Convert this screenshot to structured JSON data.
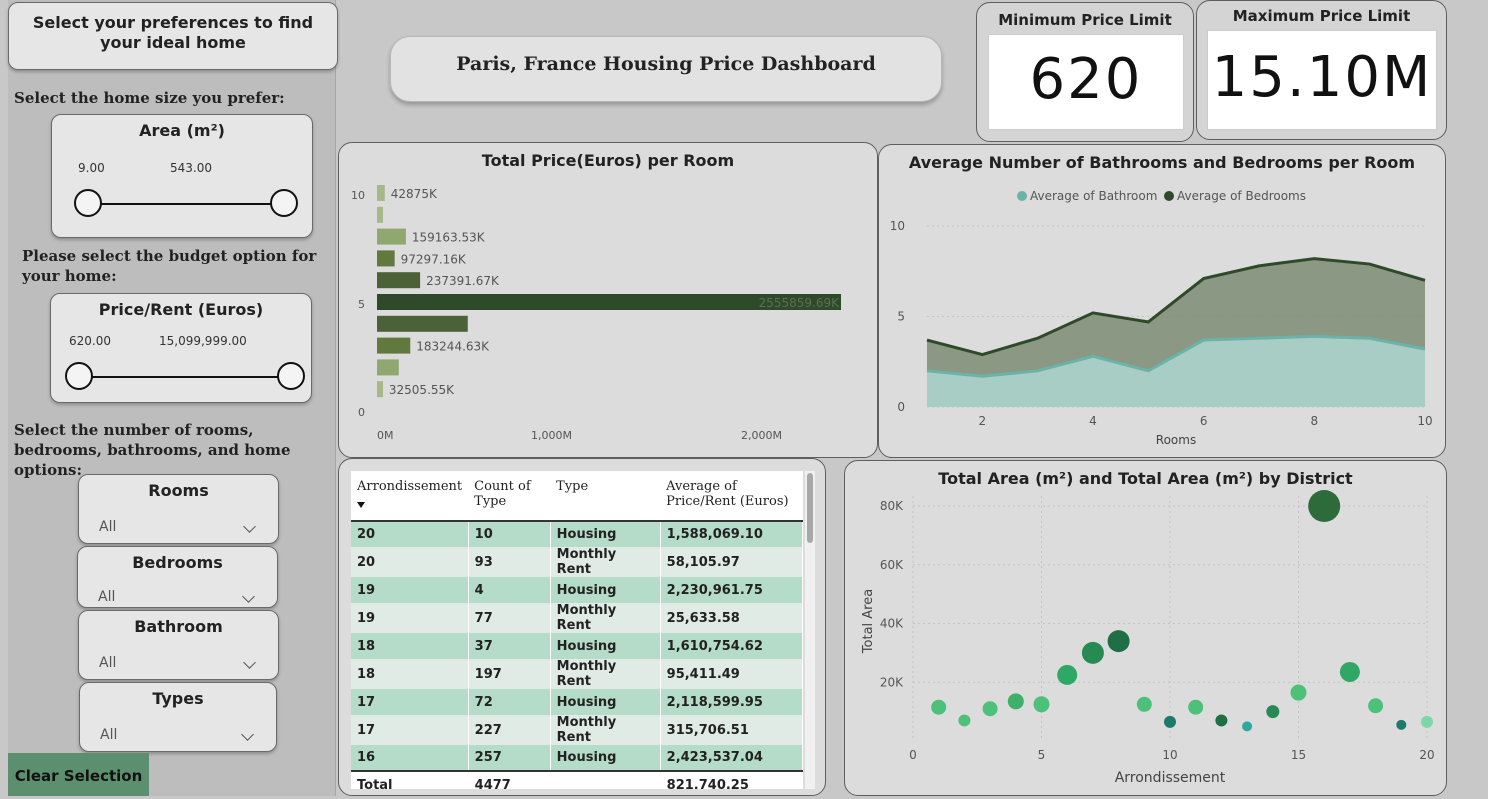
{
  "sidebar": {
    "header": "Select your preferences to find your ideal home",
    "size_prompt": "Select the home size you prefer:",
    "area_slider": {
      "title": "Area (m²)",
      "min": "9.00",
      "max": "543.00"
    },
    "budget_prompt": "Please select the budget option for your home:",
    "price_slider": {
      "title": "Price/Rent (Euros)",
      "min": "620.00",
      "max": "15,099,999.00"
    },
    "rooms_prompt": "Select the number of rooms, bedrooms, bathrooms, and home options:",
    "filters": [
      {
        "title": "Rooms",
        "value": "All"
      },
      {
        "title": "Bedrooms",
        "value": "All"
      },
      {
        "title": "Bathroom",
        "value": "All"
      },
      {
        "title": "Types",
        "value": "All"
      }
    ],
    "clear_label": "Clear Selection"
  },
  "dashboard_title": "Paris, France Housing Price Dashboard",
  "kpis": {
    "min": {
      "title": "Minimum Price Limit",
      "value": "620"
    },
    "max": {
      "title": "Maximum Price Limit",
      "value": "15.10M"
    }
  },
  "table": {
    "headers": [
      "Arrondissement",
      "Count of Type",
      "Type",
      "Average of Price/Rent (Euros)"
    ],
    "rows": [
      [
        "20",
        "10",
        "Housing",
        "1,588,069.10"
      ],
      [
        "20",
        "93",
        "Monthly Rent",
        "58,105.97"
      ],
      [
        "19",
        "4",
        "Housing",
        "2,230,961.75"
      ],
      [
        "19",
        "77",
        "Monthly Rent",
        "25,633.58"
      ],
      [
        "18",
        "37",
        "Housing",
        "1,610,754.62"
      ],
      [
        "18",
        "197",
        "Monthly Rent",
        "95,411.49"
      ],
      [
        "17",
        "72",
        "Housing",
        "2,118,599.95"
      ],
      [
        "17",
        "227",
        "Monthly Rent",
        "315,706.51"
      ],
      [
        "16",
        "257",
        "Housing",
        "2,423,537.04"
      ]
    ],
    "total": [
      "Total",
      "4477",
      "",
      "821,740.25"
    ]
  },
  "colors": {
    "dark_green": "#2f4a2a",
    "mid_green": "#4d6a3e",
    "light_green": "#8fa870",
    "teal": "#6bb3a8",
    "bubble": "#2fa866"
  },
  "chart_data": [
    {
      "type": "bar",
      "title": "Total Price(Euros) per Room",
      "orientation": "horizontal",
      "categories": [
        10,
        9,
        8,
        7,
        6,
        5,
        4,
        3,
        2,
        1
      ],
      "values": [
        42875,
        30000,
        159163.53,
        97297.16,
        237391.67,
        2555859.69,
        500000,
        183244.63,
        120000,
        32505.55
      ],
      "labels": [
        "42875K",
        "",
        "159163.53K",
        "97297.16K",
        "237391.67K",
        "2555859.69K",
        "",
        "183244.63K",
        "",
        "32505.55K"
      ],
      "x_ticks": [
        "0M",
        "1,000M",
        "2,000M"
      ],
      "y_ticks": [
        "10",
        "5",
        "0"
      ],
      "xlim": [
        0,
        2555859.69
      ]
    },
    {
      "type": "area",
      "title": "Average Number of Bathrooms and Bedrooms per Room",
      "xlabel": "Rooms",
      "x": [
        1,
        2,
        3,
        4,
        5,
        6,
        7,
        8,
        9,
        10
      ],
      "series": [
        {
          "name": "Average of Bathroom",
          "values": [
            2.0,
            1.7,
            2.0,
            2.8,
            2.0,
            3.7,
            3.8,
            3.9,
            3.8,
            3.2
          ]
        },
        {
          "name": "Average of Bedrooms",
          "values": [
            3.7,
            2.9,
            3.8,
            5.2,
            4.7,
            7.1,
            7.8,
            8.2,
            7.9,
            7.0
          ]
        }
      ],
      "x_ticks": [
        "2",
        "4",
        "6",
        "8",
        "10"
      ],
      "y_ticks": [
        "0",
        "5",
        "10"
      ],
      "ylim": [
        0,
        11
      ],
      "xlim": [
        1,
        10
      ],
      "legend": "top"
    },
    {
      "type": "scatter",
      "title": "Total Area (m²) and Total Area (m²) by District",
      "xlabel": "Arrondissement",
      "ylabel": "Total Area",
      "x_ticks": [
        "0",
        "5",
        "10",
        "15",
        "20"
      ],
      "y_ticks": [
        "20K",
        "40K",
        "60K",
        "80K"
      ],
      "xlim": [
        0,
        20
      ],
      "ylim": [
        0,
        83000
      ],
      "points": [
        {
          "x": 1,
          "y": 11500,
          "size": 15,
          "color": "#4dc07a"
        },
        {
          "x": 2,
          "y": 7000,
          "size": 12,
          "color": "#4dc07a"
        },
        {
          "x": 3,
          "y": 11000,
          "size": 15,
          "color": "#4dc07a"
        },
        {
          "x": 4,
          "y": 13500,
          "size": 16,
          "color": "#3fb06a"
        },
        {
          "x": 5,
          "y": 12500,
          "size": 16,
          "color": "#4dc07a"
        },
        {
          "x": 6,
          "y": 22500,
          "size": 20,
          "color": "#2fa866"
        },
        {
          "x": 7,
          "y": 30000,
          "size": 22,
          "color": "#268a52"
        },
        {
          "x": 8,
          "y": 34000,
          "size": 22,
          "color": "#1f6e44"
        },
        {
          "x": 9,
          "y": 12500,
          "size": 15,
          "color": "#4dc07a"
        },
        {
          "x": 10,
          "y": 6500,
          "size": 12,
          "color": "#1c7a6a"
        },
        {
          "x": 11,
          "y": 11500,
          "size": 15,
          "color": "#4dc07a"
        },
        {
          "x": 12,
          "y": 7000,
          "size": 12,
          "color": "#1f6e44"
        },
        {
          "x": 13,
          "y": 5000,
          "size": 10,
          "color": "#2fa8a0"
        },
        {
          "x": 14,
          "y": 10000,
          "size": 13,
          "color": "#268a52"
        },
        {
          "x": 15,
          "y": 16500,
          "size": 16,
          "color": "#4dc07a"
        },
        {
          "x": 16,
          "y": 80000,
          "size": 32,
          "color": "#2e6b3a"
        },
        {
          "x": 17,
          "y": 23500,
          "size": 20,
          "color": "#2fa866"
        },
        {
          "x": 18,
          "y": 12000,
          "size": 15,
          "color": "#4dc07a"
        },
        {
          "x": 19,
          "y": 5500,
          "size": 10,
          "color": "#1c7a6a"
        },
        {
          "x": 20,
          "y": 6500,
          "size": 12,
          "color": "#7fd6a6"
        }
      ]
    }
  ]
}
